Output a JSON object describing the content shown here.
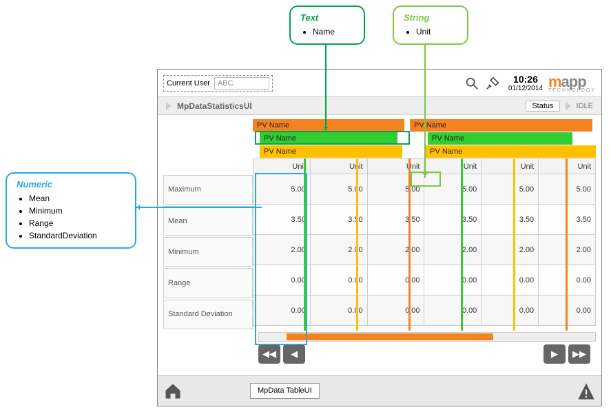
{
  "callouts": {
    "text": {
      "title": "Text",
      "items": [
        "Name"
      ]
    },
    "string": {
      "title": "String",
      "items": [
        "Unit"
      ]
    },
    "numeric": {
      "title": "Numeric",
      "items": [
        "Mean",
        "Minimum",
        "Range",
        "StandardDeviation"
      ]
    }
  },
  "topbar": {
    "current_user_label": "Current User",
    "current_user_value": "ABC",
    "time": "10:26",
    "date": "01/12/2014",
    "logo_m": "m",
    "logo_rest": "app",
    "logo_sub": "TECHNOLOGY"
  },
  "subheader": {
    "title": "MpDataStatisticsUI",
    "status_label": "Status",
    "status_value": "IDLE"
  },
  "pv_label": "PV Name",
  "unit_label": "Unit",
  "row_labels": [
    "Maximum",
    "Mean",
    "Minimum",
    "Range",
    "Standard Deviation"
  ],
  "columns": 6,
  "data": {
    "Maximum": [
      "5.00",
      "5.00",
      "5.00",
      "5.00",
      "5.00",
      "5.00"
    ],
    "Mean": [
      "3.50",
      "3.50",
      "3.50",
      "3.50",
      "3.50",
      "3.50"
    ],
    "Minimum": [
      "2.00",
      "2.00",
      "2.00",
      "2.00",
      "2.00",
      "2.00"
    ],
    "Range": [
      "0.00",
      "0.00",
      "0.00",
      "0.00",
      "0.00",
      "0.00"
    ],
    "Standard Deviation": [
      "0.00",
      "0.00",
      "0.00",
      "0.00",
      "0.00",
      "0.00"
    ]
  },
  "footer": {
    "tab": "MpData TableUI"
  }
}
